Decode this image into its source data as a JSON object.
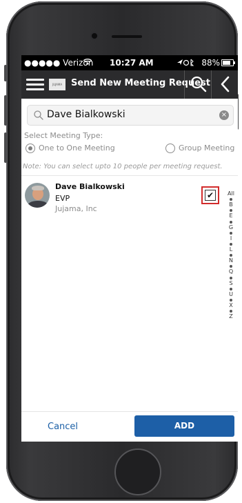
{
  "status_bar": {
    "carrier": "●●●●● Verizon",
    "time": "10:27 AM",
    "battery": "88%"
  },
  "nav": {
    "title": "Send New Meeting Request",
    "logo_text": "JUJAMA"
  },
  "search": {
    "value": "Dave Bialkowski",
    "clear_symbol": "×"
  },
  "meeting_type": {
    "label": "Select Meeting Type:",
    "options": [
      {
        "label": "One to One Meeting",
        "selected": true
      },
      {
        "label": "Group Meeting",
        "selected": false
      }
    ]
  },
  "note": "Note: You can select upto 10 people per meeting request.",
  "contacts": [
    {
      "name": "Dave Bialkowski",
      "title": "EVP",
      "company": "Jujama, Inc",
      "checked": true,
      "check_mark": "✔"
    }
  ],
  "index_letters": [
    "All",
    "B",
    "E",
    "G",
    "I",
    "L",
    "N",
    "Q",
    "S",
    "U",
    "X",
    "Z"
  ],
  "footer": {
    "cancel_label": "Cancel",
    "add_label": "ADD"
  },
  "colors": {
    "accent": "#1d5fa7",
    "nav_bg": "#2b2b2d",
    "checkbox_highlight": "#d22b2b"
  }
}
